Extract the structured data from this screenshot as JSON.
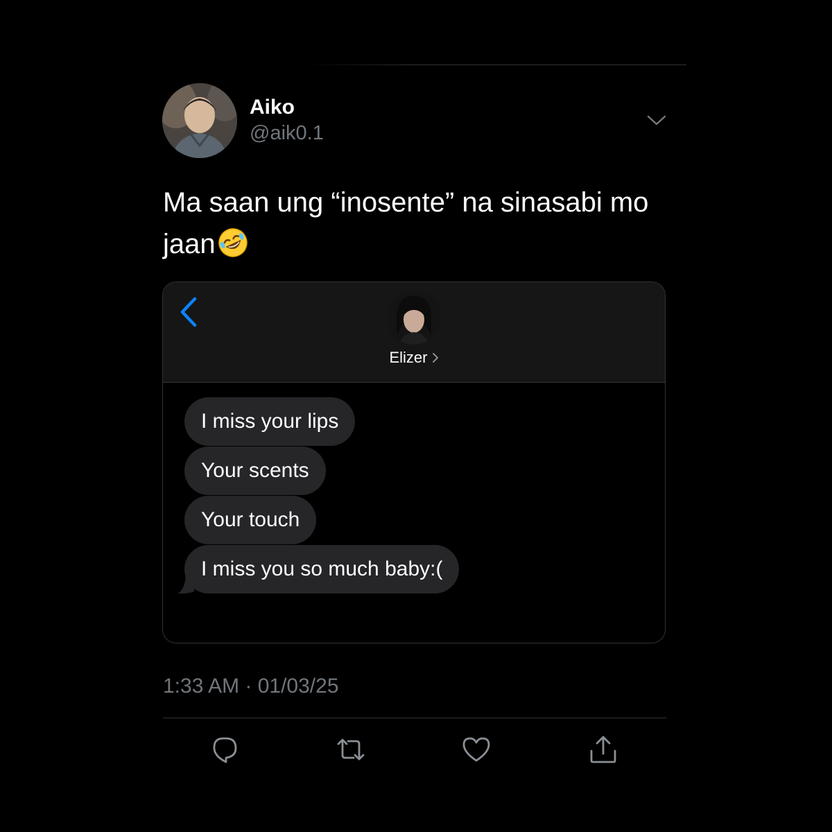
{
  "tweet": {
    "author": {
      "display_name": "Aiko",
      "handle": "@aik0.1",
      "avatar_icon": "profile-photo"
    },
    "text": "Ma saan ung “inosente” na sinasabi mo jaan",
    "emoji_icon": "rolling-on-floor-laughing-emoji",
    "timestamp": "1:33 AM · 01/03/25",
    "more_icon": "chevron-down-icon"
  },
  "chat_screenshot": {
    "back_icon": "chevron-left-icon",
    "contact_name": "Elizer",
    "contact_avatar_icon": "profile-photo",
    "accent_color": "#0a84ff",
    "bubble_color": "#262629",
    "messages": [
      "I miss your lips",
      "Your scents",
      "Your touch",
      "I miss you so much baby:("
    ]
  },
  "actions": [
    {
      "icon": "reply-icon"
    },
    {
      "icon": "retweet-icon"
    },
    {
      "icon": "like-icon"
    },
    {
      "icon": "share-icon"
    }
  ],
  "colors": {
    "background": "#000000",
    "text_primary": "#ffffff",
    "text_secondary": "#71767b",
    "divider": "#2f3336"
  }
}
